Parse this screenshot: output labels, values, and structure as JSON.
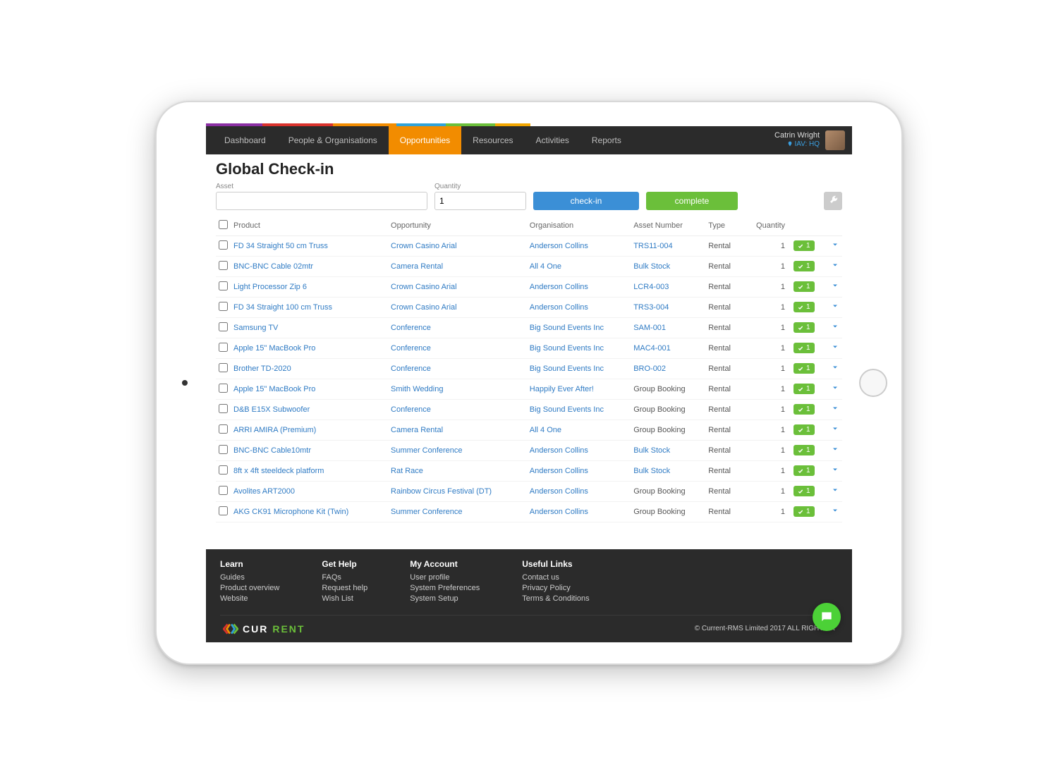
{
  "colors": {
    "strip": [
      "#8a2fa3",
      "#d9322c",
      "#f28c00",
      "#2fa2d9",
      "#6bbf3a",
      "#f2a600"
    ]
  },
  "nav": {
    "tabs": [
      "Dashboard",
      "People & Organisations",
      "Opportunities",
      "Resources",
      "Activities",
      "Reports"
    ],
    "active": 2,
    "user_name": "Catrin Wright",
    "user_location": "IAV: HQ"
  },
  "page": {
    "title": "Global Check-in"
  },
  "form": {
    "asset_label": "Asset",
    "asset_value": "",
    "quantity_label": "Quantity",
    "quantity_value": "1",
    "checkin_label": "check-in",
    "complete_label": "complete"
  },
  "table": {
    "headers": [
      "Product",
      "Opportunity",
      "Organisation",
      "Asset Number",
      "Type",
      "Quantity"
    ],
    "rows": [
      {
        "product": "FD 34 Straight 50 cm Truss",
        "opportunity": "Crown Casino Arial",
        "organisation": "Anderson Collins",
        "asset": "TRS11-004",
        "asset_link": true,
        "type": "Rental",
        "qty": "1",
        "chip": "1"
      },
      {
        "product": "BNC-BNC Cable 02mtr",
        "opportunity": "Camera Rental",
        "organisation": "All 4 One",
        "asset": "Bulk Stock",
        "asset_link": true,
        "type": "Rental",
        "qty": "1",
        "chip": "1"
      },
      {
        "product": "Light Processor Zip 6",
        "opportunity": "Crown Casino Arial",
        "organisation": "Anderson Collins",
        "asset": "LCR4-003",
        "asset_link": true,
        "type": "Rental",
        "qty": "1",
        "chip": "1"
      },
      {
        "product": "FD 34 Straight 100 cm Truss",
        "opportunity": "Crown Casino Arial",
        "organisation": "Anderson Collins",
        "asset": "TRS3-004",
        "asset_link": true,
        "type": "Rental",
        "qty": "1",
        "chip": "1"
      },
      {
        "product": "Samsung TV",
        "opportunity": "Conference",
        "organisation": "Big Sound Events Inc",
        "asset": "SAM-001",
        "asset_link": true,
        "type": "Rental",
        "qty": "1",
        "chip": "1"
      },
      {
        "product": "Apple 15\" MacBook Pro",
        "opportunity": "Conference",
        "organisation": "Big Sound Events Inc",
        "asset": "MAC4-001",
        "asset_link": true,
        "type": "Rental",
        "qty": "1",
        "chip": "1"
      },
      {
        "product": "Brother TD-2020",
        "opportunity": "Conference",
        "organisation": "Big Sound Events Inc",
        "asset": "BRO-002",
        "asset_link": true,
        "type": "Rental",
        "qty": "1",
        "chip": "1"
      },
      {
        "product": "Apple 15\" MacBook Pro",
        "opportunity": "Smith Wedding",
        "organisation": "Happily Ever After!",
        "asset": "Group Booking",
        "asset_link": false,
        "type": "Rental",
        "qty": "1",
        "chip": "1"
      },
      {
        "product": "D&B E15X Subwoofer",
        "opportunity": "Conference",
        "organisation": "Big Sound Events Inc",
        "asset": "Group Booking",
        "asset_link": false,
        "type": "Rental",
        "qty": "1",
        "chip": "1"
      },
      {
        "product": "ARRI AMIRA (Premium)",
        "opportunity": "Camera Rental",
        "organisation": "All 4 One",
        "asset": "Group Booking",
        "asset_link": false,
        "type": "Rental",
        "qty": "1",
        "chip": "1"
      },
      {
        "product": "BNC-BNC Cable10mtr",
        "opportunity": "Summer Conference",
        "organisation": "Anderson Collins",
        "asset": "Bulk Stock",
        "asset_link": true,
        "type": "Rental",
        "qty": "1",
        "chip": "1"
      },
      {
        "product": "8ft x 4ft steeldeck platform",
        "opportunity": "Rat Race",
        "organisation": "Anderson Collins",
        "asset": "Bulk Stock",
        "asset_link": true,
        "type": "Rental",
        "qty": "1",
        "chip": "1"
      },
      {
        "product": "Avolites ART2000",
        "opportunity": "Rainbow Circus Festival (DT)",
        "organisation": "Anderson Collins",
        "asset": "Group Booking",
        "asset_link": false,
        "type": "Rental",
        "qty": "1",
        "chip": "1"
      },
      {
        "product": "AKG CK91 Microphone Kit (Twin)",
        "opportunity": "Summer Conference",
        "organisation": "Anderson Collins",
        "asset": "Group Booking",
        "asset_link": false,
        "type": "Rental",
        "qty": "1",
        "chip": "1"
      }
    ]
  },
  "footer": {
    "cols": [
      {
        "title": "Learn",
        "links": [
          "Guides",
          "Product overview",
          "Website"
        ]
      },
      {
        "title": "Get Help",
        "links": [
          "FAQs",
          "Request help",
          "Wish List"
        ]
      },
      {
        "title": "My Account",
        "links": [
          "User profile",
          "System Preferences",
          "System Setup"
        ]
      },
      {
        "title": "Useful Links",
        "links": [
          "Contact us",
          "Privacy Policy",
          "Terms & Conditions"
        ]
      }
    ],
    "brand_cur": "CUR",
    "brand_rent": "RENT",
    "copyright": "© Current-RMS Limited 2017 ALL RIGHTS R"
  }
}
